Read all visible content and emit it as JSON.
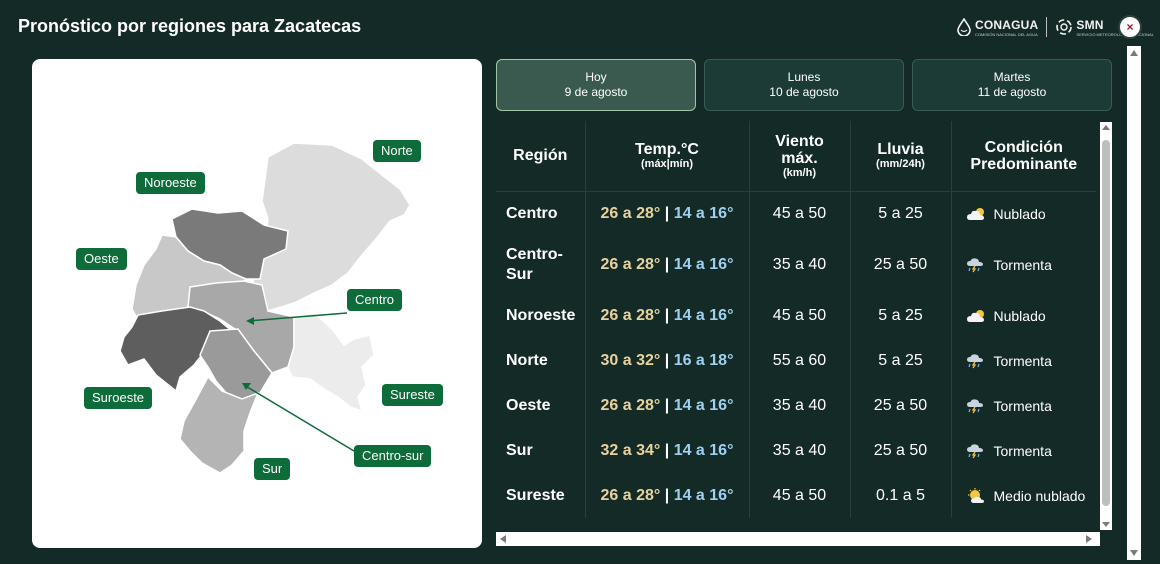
{
  "header": {
    "title": "Pronóstico por regiones para Zacatecas",
    "logo_conagua": "CONAGUA",
    "logo_conagua_sub": "COMISIÓN NACIONAL DEL AGUA",
    "logo_smn": "SMN",
    "logo_smn_sub": "SERVICIO METEOROLÓGICO NACIONAL",
    "close_label": "×",
    "close_color": "#a0192e"
  },
  "map": {
    "labels": {
      "norte": "Norte",
      "noroeste": "Noroeste",
      "oeste": "Oeste",
      "centro": "Centro",
      "suroeste": "Suroeste",
      "sureste": "Sureste",
      "centro_sur": "Centro-sur",
      "sur": "Sur"
    },
    "label_color": "#0e6b3a"
  },
  "tabs": [
    {
      "day": "Hoy",
      "date": "9 de agosto",
      "active": true
    },
    {
      "day": "Lunes",
      "date": "10 de agosto",
      "active": false
    },
    {
      "day": "Martes",
      "date": "11 de agosto",
      "active": false
    }
  ],
  "table": {
    "headers": {
      "region": "Región",
      "temp": "Temp.°C",
      "temp_sub": "(máx|mín)",
      "wind_l1": "Viento",
      "wind_l2": "máx.",
      "wind_sub": "(km/h)",
      "rain": "Lluvia",
      "rain_sub": "(mm/24h)",
      "cond_l1": "Condición",
      "cond_l2": "Predominante"
    },
    "rows": [
      {
        "region_l1": "Centro",
        "region_l2": "",
        "tmax": "26 a 28°",
        "tmin": "14 a 16°",
        "wind": "45 a 50",
        "rain": "5 a 25",
        "cond": "Nublado",
        "icon": "partly-cloudy-icon"
      },
      {
        "region_l1": "Centro-",
        "region_l2": "Sur",
        "tmax": "26 a 28°",
        "tmin": "14 a 16°",
        "wind": "35 a 40",
        "rain": "25 a 50",
        "cond": "Tormenta",
        "icon": "storm-icon"
      },
      {
        "region_l1": "Noroeste",
        "region_l2": "",
        "tmax": "26 a 28°",
        "tmin": "14 a 16°",
        "wind": "45 a 50",
        "rain": "5 a 25",
        "cond": "Nublado",
        "icon": "partly-cloudy-icon"
      },
      {
        "region_l1": "Norte",
        "region_l2": "",
        "tmax": "30 a 32°",
        "tmin": "16 a 18°",
        "wind": "55 a 60",
        "rain": "5 a 25",
        "cond": "Tormenta",
        "icon": "storm-icon"
      },
      {
        "region_l1": "Oeste",
        "region_l2": "",
        "tmax": "26 a 28°",
        "tmin": "14 a 16°",
        "wind": "35 a 40",
        "rain": "25 a 50",
        "cond": "Tormenta",
        "icon": "storm-icon"
      },
      {
        "region_l1": "Sur",
        "region_l2": "",
        "tmax": "32 a 34°",
        "tmin": "14 a 16°",
        "wind": "35 a 40",
        "rain": "25 a 50",
        "cond": "Tormenta",
        "icon": "storm-icon"
      },
      {
        "region_l1": "Sureste",
        "region_l2": "",
        "tmax": "26 a 28°",
        "tmin": "14 a 16°",
        "wind": "45 a 50",
        "rain": "0.1 a 5",
        "cond": "Medio nublado",
        "icon": "sun-cloud-icon"
      }
    ],
    "colors": {
      "tmax": "#e6d3a0",
      "tmin": "#9fd0ef"
    }
  }
}
